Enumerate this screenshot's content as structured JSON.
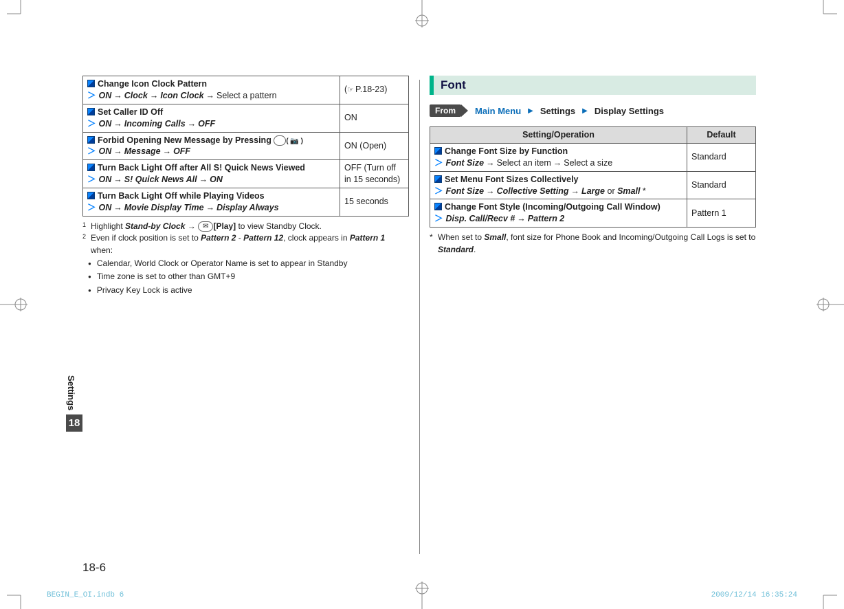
{
  "left_table": {
    "rows": [
      {
        "title": "Change Icon Clock Pattern",
        "ops": [
          "ON",
          "Clock",
          "Icon Clock"
        ],
        "tail": "Select a pattern",
        "default_prefix": "(",
        "default_hand": "☞",
        "default": "P.18-23)",
        "key_icon": null
      },
      {
        "title": "Set Caller ID Off",
        "ops": [
          "ON",
          "Incoming Calls",
          "OFF"
        ],
        "tail": "",
        "default": "ON",
        "key_icon": null
      },
      {
        "title_a": "Forbid Opening New Message by Pressing ",
        "key_icon": "●",
        "key_icon2": "( 📷 )",
        "ops": [
          "ON",
          "Message",
          "OFF"
        ],
        "tail": "",
        "default": "ON (Open)"
      },
      {
        "title": "Turn Back Light Off after All S! Quick News Viewed",
        "ops": [
          "ON",
          "S! Quick News All",
          "ON"
        ],
        "tail": "",
        "default": "OFF (Turn off in 15 seconds)",
        "key_icon": null
      },
      {
        "title": "Turn Back Light Off while Playing Videos",
        "ops": [
          "ON",
          "Movie Display Time",
          "Display Always"
        ],
        "tail": "",
        "default": "15 seconds",
        "key_icon": null
      }
    ]
  },
  "footnote1_pre": "Highlight ",
  "footnote1_ital": "Stand-by Clock",
  "footnote1_mid": " → ",
  "footnote1_key": "✉",
  "footnote1_play": "[Play]",
  "footnote1_post": " to view Standby Clock.",
  "footnote2_pre": "Even if clock position is set to ",
  "footnote2_p2": "Pattern 2",
  "footnote2_dash": " - ",
  "footnote2_p12": "Pattern 12",
  "footnote2_mid": ", clock appears in ",
  "footnote2_p1": "Pattern 1",
  "footnote2_post": " when:",
  "bullets": [
    "Calendar, World Clock or Operator Name is set to appear in Standby",
    "Time zone is set to other than GMT+9",
    "Privacy Key Lock is active"
  ],
  "right_section_title": "Font",
  "from_label": "From",
  "from_path": [
    "Main Menu",
    "Settings",
    "Display Settings"
  ],
  "right_header_setting": "Setting/Operation",
  "right_header_default": "Default",
  "right_table": {
    "rows": [
      {
        "title": "Change Font Size by Function",
        "op0": "Font Size",
        "tail1": "Select an item",
        "tail2": "Select a size",
        "default": "Standard"
      },
      {
        "title": "Set Menu Font Sizes Collectively",
        "op0": "Font Size",
        "op1": "Collective Setting",
        "op2": "Large",
        "or": " or ",
        "op3": "Small",
        "ast": " *",
        "default": "Standard"
      },
      {
        "title": "Change Font Style (Incoming/Outgoing Call Window)",
        "op0": "Disp. Call/Recv #",
        "op1": "Pattern 2",
        "default": "Pattern 1"
      }
    ]
  },
  "right_note_pre": "When set to ",
  "right_note_small": "Small",
  "right_note_mid": ", font size for Phone Book and Incoming/Outgoing Call Logs is set to ",
  "right_note_standard": "Standard",
  "right_note_post": ".",
  "side_tab_label": "Settings",
  "side_tab_num": "18",
  "page_num": "18-6",
  "footer_left": "BEGIN_E_OI.indb   6",
  "footer_right": "2009/12/14   16:35:24"
}
